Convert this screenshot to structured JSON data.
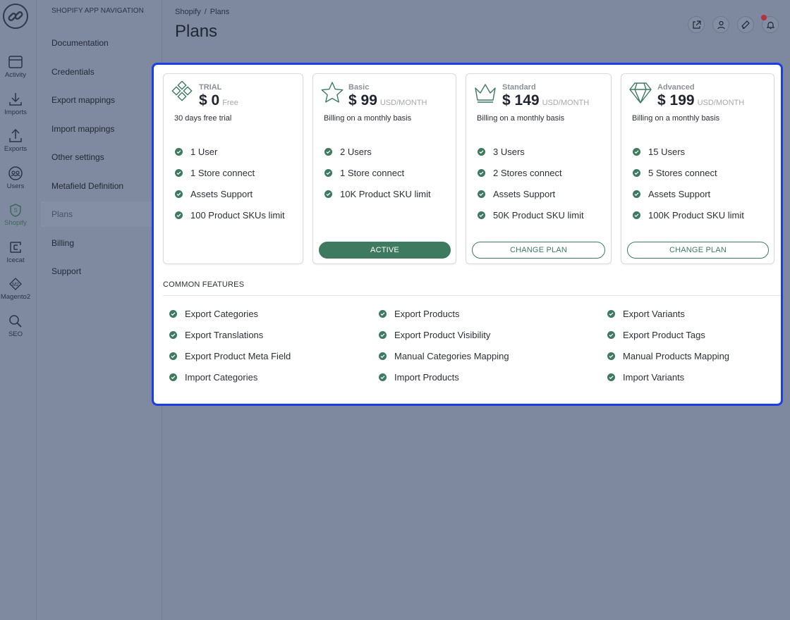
{
  "rail": {
    "items": [
      {
        "label": "Activity",
        "icon": "calendar-icon"
      },
      {
        "label": "Imports",
        "icon": "download-icon"
      },
      {
        "label": "Exports",
        "icon": "upload-icon"
      },
      {
        "label": "Users",
        "icon": "users-icon"
      },
      {
        "label": "Shopify",
        "icon": "shopify-icon"
      },
      {
        "label": "Icecat",
        "icon": "icecat-icon"
      },
      {
        "label": "Magento2",
        "icon": "magento-icon"
      },
      {
        "label": "SEO",
        "icon": "magnifier-icon"
      }
    ]
  },
  "subnav": {
    "title": "SHOPIFY APP NAVIGATION",
    "items": [
      {
        "label": "Documentation"
      },
      {
        "label": "Credentials"
      },
      {
        "label": "Export mappings"
      },
      {
        "label": "Import mappings"
      },
      {
        "label": "Other settings"
      },
      {
        "label": "Metafield Definition"
      },
      {
        "label": "Plans"
      },
      {
        "label": "Billing"
      },
      {
        "label": "Support"
      }
    ]
  },
  "header": {
    "breadcrumb": {
      "parent": "Shopify",
      "separator": "/",
      "current": "Plans"
    },
    "title": "Plans"
  },
  "plans": [
    {
      "name": "TRIAL",
      "price": "$ 0",
      "unit": "Free",
      "description": "30 days free trial",
      "icon": "diamonds-pattern-icon",
      "features": [
        "1 User",
        "1 Store connect",
        "Assets Support",
        "100 Product SKUs limit"
      ],
      "button": ""
    },
    {
      "name": "Basic",
      "price": "$ 99",
      "unit": "USD/MONTH",
      "description": "Billing on a monthly basis",
      "icon": "star-icon",
      "features": [
        "2 Users",
        "1 Store connect",
        "10K Product SKU limit"
      ],
      "button": "ACTIVE"
    },
    {
      "name": "Standard",
      "price": "$ 149",
      "unit": "USD/MONTH",
      "description": "Billing on a monthly basis",
      "icon": "crown-icon",
      "features": [
        "3 Users",
        "2 Stores connect",
        "Assets Support",
        "50K Product SKU limit"
      ],
      "button": "CHANGE PLAN"
    },
    {
      "name": "Advanced",
      "price": "$ 199",
      "unit": "USD/MONTH",
      "description": "Billing on a monthly basis",
      "icon": "gem-icon",
      "features": [
        "15 Users",
        "5 Stores connect",
        "Assets Support",
        "100K Product SKU limit"
      ],
      "button": "CHANGE PLAN"
    }
  ],
  "common": {
    "title": "COMMON FEATURES",
    "features": [
      "Export Categories",
      "Export Products",
      "Export Variants",
      "Export Translations",
      "Export Product Visibility",
      "Export Product Tags",
      "Export Product Meta Field",
      "Manual Categories Mapping",
      "Manual Products Mapping",
      "Import Categories",
      "Import Products",
      "Import Variants"
    ]
  },
  "colors": {
    "accent": "#3d7a60",
    "modal_border": "#1c3ee6",
    "notification": "#b4323c"
  }
}
